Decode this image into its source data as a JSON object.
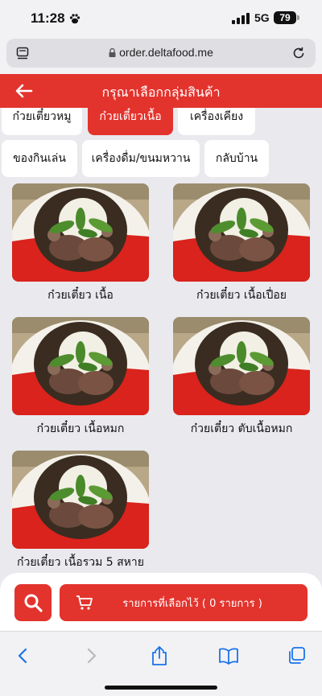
{
  "status_bar": {
    "time": "11:28",
    "network": "5G",
    "battery": "79"
  },
  "browser": {
    "url": "order.deltafood.me"
  },
  "header": {
    "title": "กรุณาเลือกกลุ่มสินค้า"
  },
  "categories": [
    {
      "label": "ก๋วยเตี๋ยวหมู",
      "active": false
    },
    {
      "label": "ก๋วยเตี๋ยวเนื้อ",
      "active": true
    },
    {
      "label": "เครื่องเคียง",
      "active": false
    },
    {
      "label": "ของกินเล่น",
      "active": false
    },
    {
      "label": "เครื่องดื่ม/ขนมหวาน",
      "active": false
    },
    {
      "label": "กลับบ้าน",
      "active": false
    }
  ],
  "products": [
    {
      "name": "ก๋วยเตี๋ยว เนื้อ"
    },
    {
      "name": "ก๋วยเตี๋ยว เนื้อเปื่อย"
    },
    {
      "name": "ก๋วยเตี๋ยว เนื้อหมก"
    },
    {
      "name": "ก๋วยเตี๋ยว ตับเนื้อหมก"
    },
    {
      "name": "ก๋วยเตี๋ยว เนื้อรวม 5 สหาย"
    }
  ],
  "cart": {
    "label": "รายการที่เลือกไว้ ( 0 รายการ )"
  },
  "icons": {
    "back": "arrow-left-icon",
    "search": "search-icon",
    "cart": "cart-icon",
    "lock": "lock-icon",
    "reload": "reload-icon"
  },
  "colors": {
    "accent": "#e3332d",
    "background": "#e9e9ee"
  }
}
